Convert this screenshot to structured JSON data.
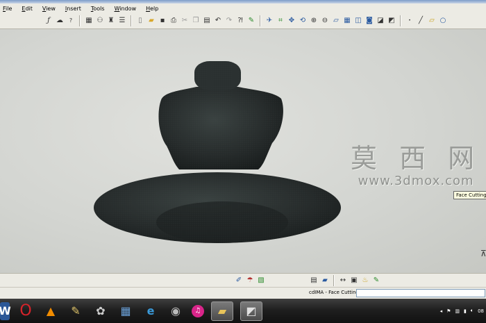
{
  "menu": [
    "File",
    "Edit",
    "View",
    "Insert",
    "Tools",
    "Window",
    "Help"
  ],
  "toolbar_icons": [
    "formula-icon",
    "knowledge-icon",
    "help-icon",
    "table-icon",
    "catalog-icon",
    "bomb-icon",
    "settings-icon",
    "new-icon",
    "open-icon",
    "save-icon",
    "print-icon",
    "cut-icon",
    "copy-icon",
    "paste-icon",
    "undo-icon",
    "redo-icon",
    "whats-this-icon",
    "fly-mode-icon",
    "fit-all-icon",
    "pan-icon",
    "rotate-icon",
    "zoom-in-icon",
    "zoom-out-icon",
    "normal-view-icon",
    "multi-view-icon",
    "iso-view-icon",
    "shading-icon",
    "hide-show-icon",
    "swap-icon",
    "point-icon",
    "line-icon",
    "plane-icon",
    "circle-icon"
  ],
  "viewport": {
    "watermark_cn": "莫 西 网",
    "watermark_url": "www.3dmox.com",
    "tooltip": "Face Cutting"
  },
  "bottom_toolbar_icons": [
    "measure-icon",
    "apply-material-icon",
    "analysis-icon",
    "catalog-browser-icon",
    "eraser-icon",
    "dimension-icon",
    "clip-icon",
    "thermometer-icon",
    "sketch-icon"
  ],
  "status": {
    "text": "cdIMA - Face Cutting",
    "command_value": ""
  },
  "taskbar": {
    "apps": [
      "word-icon",
      "opera-icon",
      "vlc-icon",
      "paint-icon",
      "photoshop-icon",
      "catia-icon",
      "internet-explorer-icon",
      "webcam-icon",
      "itunes-icon",
      "file-explorer-icon",
      "catia-window-icon"
    ],
    "clock": "08"
  },
  "colors": {
    "model": "#2a3030",
    "viewport_bg": "#d4d6d2",
    "taskbar": "#1f1f1f"
  }
}
